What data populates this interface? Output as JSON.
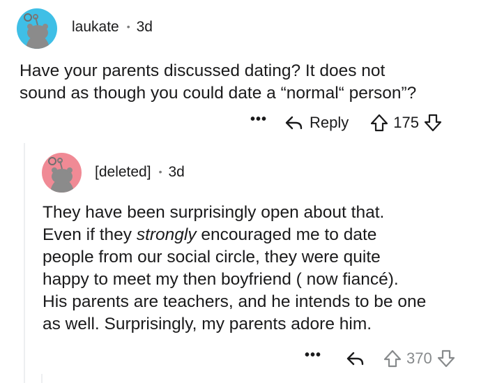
{
  "comment": {
    "username": "laukate",
    "separator": "•",
    "age": "3d",
    "lines": [
      "Have your parents discussed dating? It does not",
      "sound as though you could date a “normal“ person”?"
    ],
    "more_label": "•••",
    "reply_label": "Reply",
    "score": "175",
    "avatar_color": "#3fbfe6"
  },
  "reply": {
    "username": "[deleted]",
    "separator": "•",
    "age": "3d",
    "lines": [
      {
        "before": "They have been surprisingly open about that.",
        "em": "",
        "after": ""
      },
      {
        "before": "Even if they ",
        "em": "strongly",
        "after": " encouraged me to date"
      },
      {
        "before": "people from our social circle, they were quite",
        "em": "",
        "after": ""
      },
      {
        "before": "happy to meet my then boyfriend ( now fiancé).",
        "em": "",
        "after": ""
      },
      {
        "before": "His parents are teachers, and he intends to be one",
        "em": "",
        "after": ""
      },
      {
        "before": "as well. Surprisingly, my parents adore him.",
        "em": "",
        "after": ""
      }
    ],
    "more_label": "•••",
    "score": "370",
    "avatar_color": "#f08a95"
  }
}
